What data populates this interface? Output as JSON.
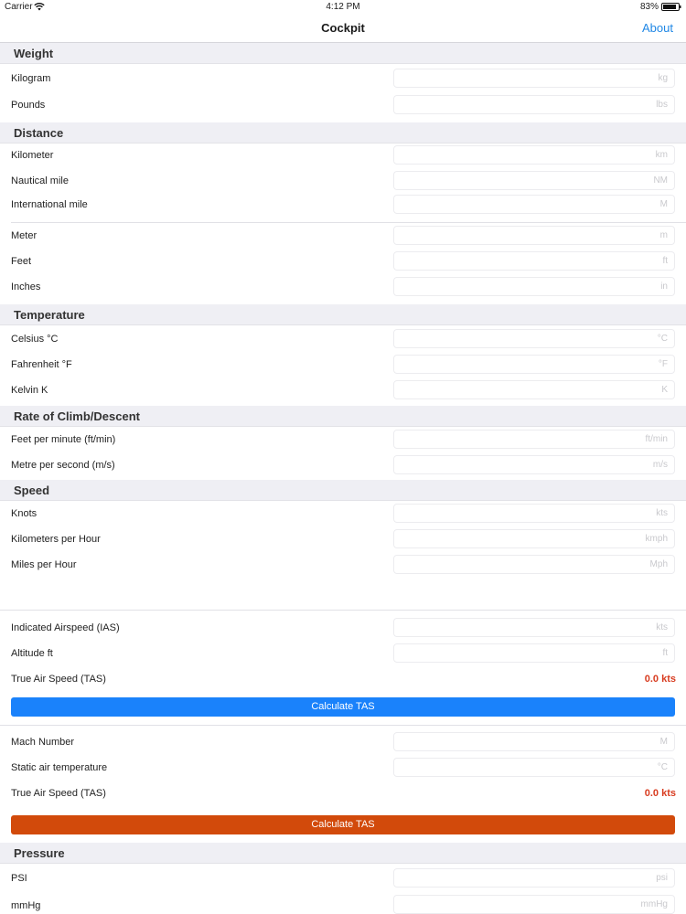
{
  "status": {
    "carrier": "Carrier",
    "time": "4:12 PM",
    "battery": "83%"
  },
  "nav": {
    "title": "Cockpit",
    "about": "About"
  },
  "colors": {
    "accent": "#1f87e5",
    "blue_button": "#1a82fb",
    "orange_button": "#d24a0b",
    "result": "#d83c20"
  },
  "weight": {
    "header": "Weight",
    "kilogram": {
      "label": "Kilogram",
      "placeholder": "kg"
    },
    "pounds": {
      "label": "Pounds",
      "placeholder": "lbs"
    }
  },
  "distance": {
    "header": "Distance",
    "kilometer": {
      "label": "Kilometer",
      "placeholder": "km"
    },
    "nautical": {
      "label": "Nautical mile",
      "placeholder": "NM"
    },
    "intl": {
      "label": "International mile",
      "placeholder": "M"
    },
    "meter": {
      "label": "Meter",
      "placeholder": "m"
    },
    "feet": {
      "label": "Feet",
      "placeholder": "ft"
    },
    "inches": {
      "label": "Inches",
      "placeholder": "in"
    }
  },
  "temperature": {
    "header": "Temperature",
    "celsius": {
      "label": "Celsius °C",
      "placeholder": "°C"
    },
    "fahrenheit": {
      "label": "Fahrenheit °F",
      "placeholder": "°F"
    },
    "kelvin": {
      "label": "Kelvin K",
      "placeholder": "K"
    }
  },
  "climb": {
    "header": "Rate of Climb/Descent",
    "fpm": {
      "label": "Feet per minute (ft/min)",
      "placeholder": "ft/min"
    },
    "mps": {
      "label": "Metre per second (m/s)",
      "placeholder": "m/s"
    }
  },
  "speed": {
    "header": "Speed",
    "knots": {
      "label": "Knots",
      "placeholder": "kts"
    },
    "kmph": {
      "label": "Kilometers per Hour",
      "placeholder": "kmph"
    },
    "mph": {
      "label": "Miles per Hour",
      "placeholder": "Mph"
    }
  },
  "tas_ias": {
    "ias": {
      "label": "Indicated Airspeed (IAS)",
      "placeholder": "kts"
    },
    "altitude": {
      "label": "Altitude ft",
      "placeholder": "ft"
    },
    "tas_label": "True Air Speed (TAS)",
    "tas_value": "0.0 kts",
    "button": "Calculate TAS"
  },
  "tas_mach": {
    "mach": {
      "label": "Mach Number",
      "placeholder": "M"
    },
    "sat": {
      "label": "Static air temperature",
      "placeholder": "°C"
    },
    "tas_label": "True Air Speed (TAS)",
    "tas_value": "0.0 kts",
    "button": "Calculate TAS"
  },
  "pressure": {
    "header": "Pressure",
    "psi": {
      "label": "PSI",
      "placeholder": "psi"
    },
    "mmhg": {
      "label": "mmHg",
      "placeholder": "mmHg"
    }
  }
}
